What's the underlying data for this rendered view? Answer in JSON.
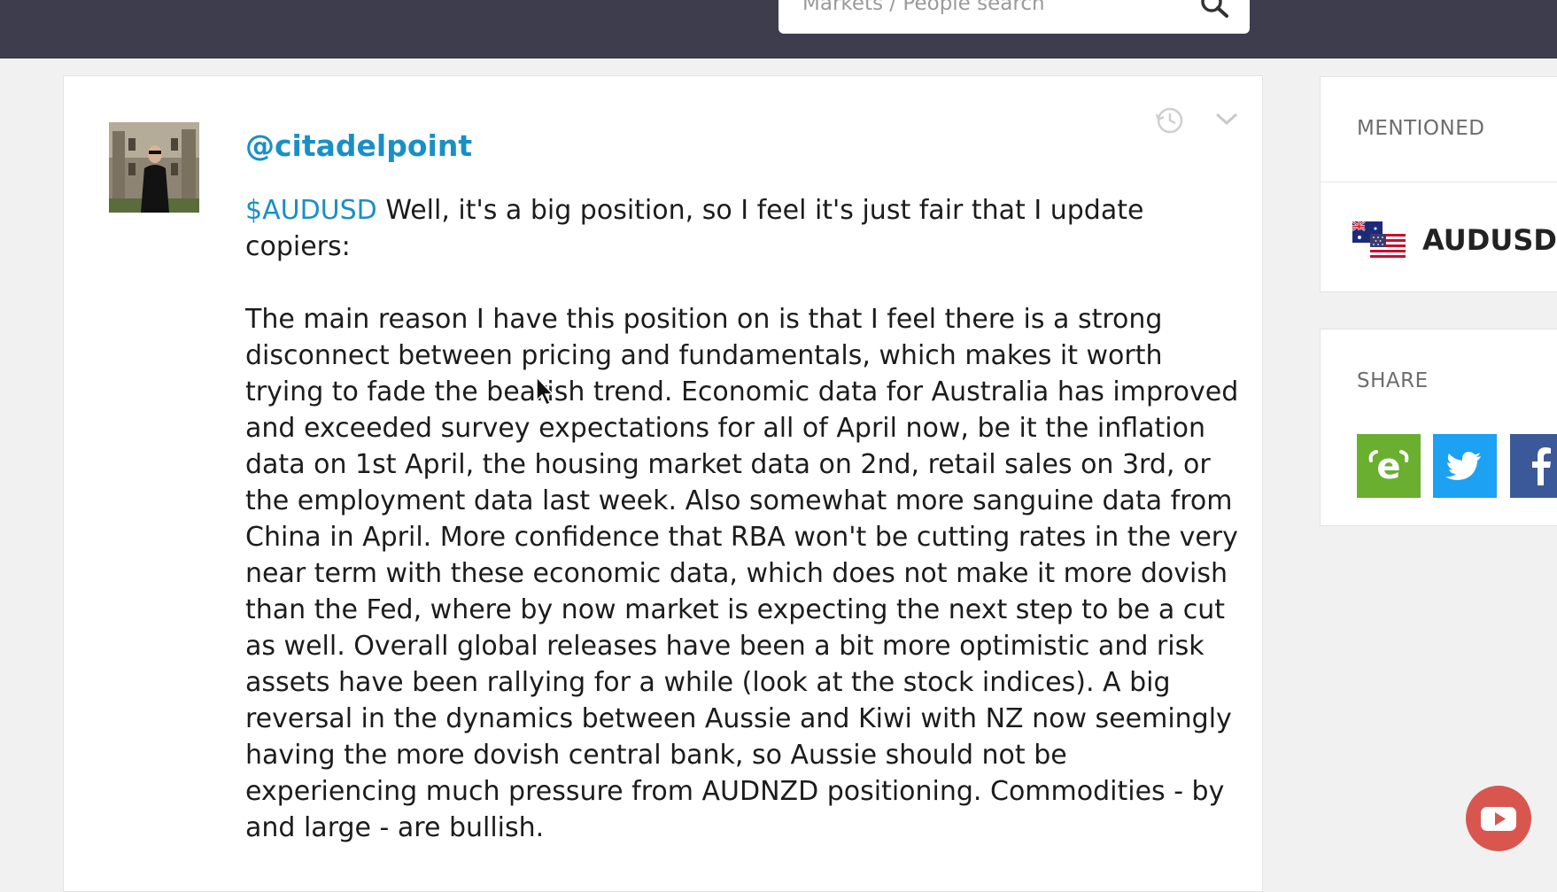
{
  "header": {
    "search_placeholder": "Markets / People search",
    "search_icon": "search-icon"
  },
  "post": {
    "username": "@citadelpoint",
    "ticker": "$AUDUSD",
    "intro_text": " Well, it's a big position, so I feel it's just fair that I update copiers:",
    "body_text": "The main reason I have this position on is that I feel there is a strong disconnect between pricing and fundamentals, which makes it worth trying to fade the bearish trend. Economic data for Australia has improved and exceeded survey expectations for all of April now, be it the inflation data on 1st April, the housing market data on 2nd, retail sales on 3rd, or the employment data last week. Also somewhat more sanguine data from China in April. More confidence that RBA won't be cutting rates in the very near term with these economic data, which does not make it more dovish than the Fed, where by now market is expecting the next step to be a cut as well. Overall global releases have been a bit more optimistic and risk assets have been rallying for a while (look at the stock indices). A big reversal in the dynamics between Aussie and Kiwi with NZ now seemingly having the more dovish central bank, so Aussie should not be experiencing much pressure from AUDNZD positioning. Commodities - by and large - are bullish.",
    "icons": [
      "history-icon",
      "chevron-down-icon"
    ]
  },
  "sidebar": {
    "mentioned_title": "MENTIONED",
    "mentioned_symbol": "AUDUSD",
    "share_title": "SHARE",
    "share_buttons": [
      "etoro-share-icon",
      "twitter-icon",
      "facebook-icon"
    ]
  },
  "colors": {
    "link": "#1a8fc7",
    "topbar": "#3d3d4d",
    "etoro_green": "#6aaf2f",
    "twitter_blue": "#1da1f2",
    "facebook_blue": "#3b5998",
    "youtube_red": "#d9564f"
  }
}
